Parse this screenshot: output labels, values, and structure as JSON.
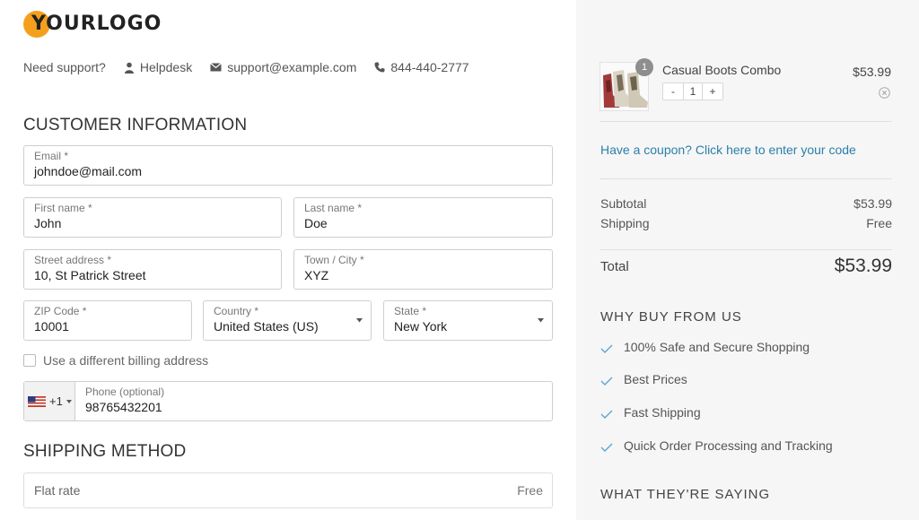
{
  "logo": {
    "text": "YOURLOGO"
  },
  "support": {
    "label": "Need support?",
    "helpdesk": "Helpdesk",
    "email": "support@example.com",
    "phone": "844-440-2777"
  },
  "customer_info": {
    "title": "CUSTOMER INFORMATION",
    "email": {
      "label": "Email *",
      "value": "johndoe@mail.com"
    },
    "first_name": {
      "label": "First name *",
      "value": "John"
    },
    "last_name": {
      "label": "Last name *",
      "value": "Doe"
    },
    "street": {
      "label": "Street address *",
      "value": "10, St Patrick Street"
    },
    "town": {
      "label": "Town / City *",
      "value": "XYZ"
    },
    "zip": {
      "label": "ZIP Code *",
      "value": "10001"
    },
    "country": {
      "label": "Country *",
      "value": "United States (US)"
    },
    "state": {
      "label": "State *",
      "value": "New York"
    },
    "billing_checkbox": "Use a different billing address",
    "phone": {
      "prefix": "+1",
      "label": "Phone (optional)",
      "value": "98765432201"
    }
  },
  "shipping_method": {
    "title": "SHIPPING METHOD",
    "option": {
      "name": "Flat rate",
      "price": "Free"
    }
  },
  "cart": {
    "item": {
      "name": "Casual Boots Combo",
      "price": "$53.99",
      "quantity": "1",
      "badge": "1",
      "minus": "-",
      "plus": "+"
    },
    "coupon": "Have a coupon? Click here to enter your code",
    "subtotal": {
      "label": "Subtotal",
      "value": "$53.99"
    },
    "shipping": {
      "label": "Shipping",
      "value": "Free"
    },
    "total": {
      "label": "Total",
      "value": "$53.99"
    }
  },
  "why_buy": {
    "title": "WHY BUY FROM US",
    "items": [
      "100% Safe and Secure Shopping",
      "Best Prices",
      "Fast Shipping",
      "Quick Order Processing and Tracking"
    ]
  },
  "testimonials": {
    "title": "WHAT THEY'RE SAYING"
  },
  "colors": {
    "accent": "#f5a01d",
    "link": "#2a7fa8",
    "check": "#5aa7d6",
    "sidebar_bg": "#f6f6f6"
  }
}
